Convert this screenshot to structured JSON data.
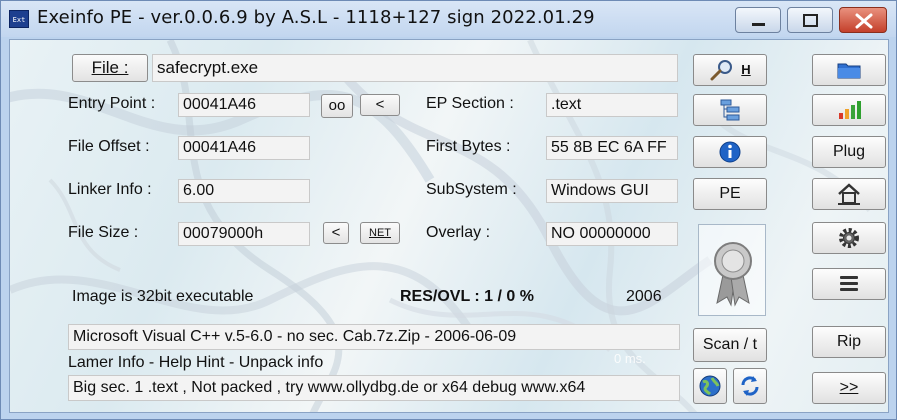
{
  "window": {
    "title": "Exeinfo PE - ver.0.0.6.9  by A.S.L -  1118+127 sign  2022.01.29",
    "app_icon_text": "Ext"
  },
  "file": {
    "button_label": "File :",
    "name": "safecrypt.exe"
  },
  "fields": {
    "entry_point_label": "Entry Point :",
    "entry_point_value": "00041A46",
    "oo_button": "oo",
    "lt_button": "<",
    "file_offset_label": "File Offset :",
    "file_offset_value": "00041A46",
    "linker_info_label": "Linker Info :",
    "linker_info_value": "6.00",
    "file_size_label": "File Size :",
    "file_size_value": "00079000h",
    "lt_button2": "<",
    "net_button": "NET",
    "ep_section_label": "EP Section :",
    "ep_section_value": ".text",
    "first_bytes_label": "First Bytes :",
    "first_bytes_value": "55 8B EC 6A FF",
    "subsystem_label": "SubSystem :",
    "subsystem_value": "Windows GUI",
    "overlay_label": "Overlay :",
    "overlay_value": "NO   00000000"
  },
  "info": {
    "image_type": "Image is 32bit executable",
    "res_ovl": "RES/OVL : 1 / 0 %",
    "year": "2006",
    "detection": "Microsoft Visual C++ v.5-6.0 - no sec. Cab.7z.Zip - 2006-06-09",
    "lamer_info": "Lamer Info - Help Hint - Unpack info",
    "time_ms": "0 ms.",
    "hint": "Big sec. 1 .text , Not packed , try  www.ollydbg.de or x64 debug www.x64"
  },
  "right_buttons": {
    "search_hotkey": "H",
    "pe_button": "PE",
    "scan_button": "Scan / t",
    "plug_button": "Plug",
    "rip_button": "Rip",
    "more_button": ">>"
  }
}
